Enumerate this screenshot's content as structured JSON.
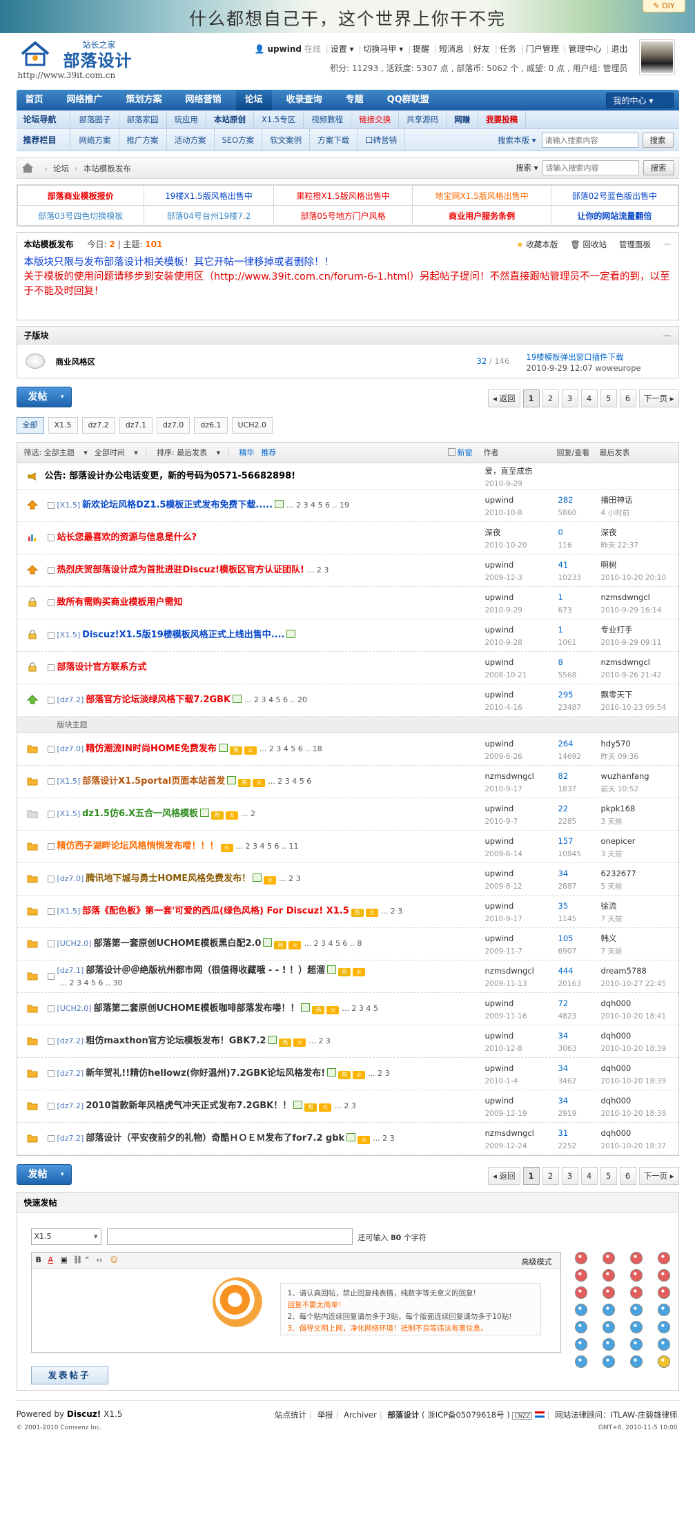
{
  "banner": {
    "slogan": "什么都想自己干，这个世界上你干不完",
    "diy": "DIY"
  },
  "logo": {
    "small": "站长之家",
    "big": "部落设计",
    "url": "http://www.39it.com.cn"
  },
  "user": {
    "name": "upwind",
    "status": "在线",
    "menu": [
      "设置",
      "切换马甲",
      "提醒",
      "短消息",
      "好友",
      "任务",
      "门户管理",
      "管理中心",
      "退出"
    ],
    "stats": "积分: 11293 , 活跃度: 5307 点 , 部落币: 5062 个 , 威望: 0 点 , 用户组: 管理员"
  },
  "nav": {
    "items": [
      "首页",
      "网络推广",
      "策划方案",
      "网络营销",
      "论坛",
      "收录查询",
      "专题",
      "QQ群联盟"
    ],
    "active": 4,
    "mycenter": "我的中心"
  },
  "subnav1": {
    "title": "论坛导航",
    "items": [
      "部落圈子",
      "部落家园",
      "玩应用",
      "本站原创",
      "X1.5专区",
      "视频教程",
      "链接交换",
      "共享源码",
      "网赚",
      "我要投稿"
    ]
  },
  "subnav2": {
    "title": "推荐栏目",
    "items": [
      "网络方案",
      "推广方案",
      "活动方案",
      "SEO方案",
      "软文案例",
      "方案下载",
      "口碑营销"
    ],
    "search_label": "搜索本版",
    "search_placeholder": "请输入搜索内容",
    "search_btn": "搜索"
  },
  "breadcrumb": {
    "items": [
      "论坛",
      "本站模板发布"
    ],
    "search_label": "搜索",
    "search_placeholder": "请输入搜索内容",
    "search_btn": "搜索"
  },
  "ads": [
    [
      "部落商业模板报价",
      "19楼X1.5版风格出售中",
      "果粒橙X1.5版风格出售中",
      "地宝网X1.5版风格出售中",
      "部落02号蓝色版出售中"
    ],
    [
      "部落03号四色切换模板",
      "部落04号台州19楼7.2",
      "部落05号地方门户风格",
      "商业用户服务条例",
      "让你的网站流量翻倍"
    ]
  ],
  "forum": {
    "name": "本站模板发布",
    "today_label": "今日:",
    "today": "2",
    "topics_label": "主题:",
    "topics": "101",
    "ops": [
      "收藏本版",
      "回收站",
      "管理面板"
    ],
    "rule1": "本版块只限与发布部落设计相关模板！其它开帖一律移掉或者删除！！",
    "rule2": "关于模板的使用问题请移步到安装使用区（http://www.39it.com.cn/forum-6-1.html）另起帖子提问！不然直接跟帖管理员不一定看的到，以至于不能及时回复！"
  },
  "subforum": {
    "title": "子版块",
    "name": "商业风格区",
    "threads": "32",
    "posts": "146",
    "last_title": "19楼模板弹出窗口插件下载",
    "last_info": "2010-9-29 12:07 woweurope"
  },
  "pager": {
    "post_btn": "发帖",
    "back": "返回",
    "pages": [
      "1",
      "2",
      "3",
      "4",
      "5",
      "6"
    ],
    "next": "下一页"
  },
  "type_tabs": [
    "全部",
    "X1.5",
    "dz7.2",
    "dz7.1",
    "dz7.0",
    "dz6.1",
    "UCH2.0"
  ],
  "list_header": {
    "filter": "筛选: 全部主题",
    "time": "全部时间",
    "sort": "排序: 最后发表",
    "digest": "精华",
    "recommend": "推荐",
    "newwin": "新窗",
    "author": "作者",
    "replies": "回复/查看",
    "lastpost": "最后发表"
  },
  "announcement": {
    "title": "公告: 部落设计办公电话变更，新的号码为0571-56682898!",
    "author": "爱，直至成伤",
    "date": "2010-9-29"
  },
  "sticky": [
    {
      "icon": "sticky3",
      "type": "[X1.5]",
      "title": "新欢论坛风格DZ1.5模板正式发布免费下载.....",
      "color": "c-blue",
      "pages": "... 2 3 4 5 6 .. 19",
      "author": "upwind",
      "date": "2010-10-8",
      "replies": "282",
      "views": "5860",
      "last_user": "播田神话",
      "last_time": "4 小时前",
      "img": true
    },
    {
      "icon": "poll",
      "type": "",
      "title": "站长您最喜欢的资源与信息是什么?",
      "color": "c-red",
      "pages": "",
      "author": "深夜",
      "date": "2010-10-20",
      "replies": "0",
      "views": "116",
      "last_user": "深夜",
      "last_time": "昨天 22:37"
    },
    {
      "icon": "sticky3",
      "type": "",
      "title": "热烈庆贺部落设计成为首批进驻Discuz!模板区官方认证团队!",
      "color": "c-red",
      "pages": "... 2 3",
      "author": "upwind",
      "date": "2009-12-3",
      "replies": "41",
      "views": "10233",
      "last_user": "啊树",
      "last_time": "2010-10-20 20:10"
    },
    {
      "icon": "lock",
      "type": "",
      "title": "致所有需购买商业模板用户需知",
      "color": "c-red",
      "pages": "",
      "author": "upwind",
      "date": "2010-9-29",
      "replies": "1",
      "views": "673",
      "last_user": "nzmsdwngcl",
      "last_time": "2010-9-29 16:14"
    },
    {
      "icon": "lock",
      "type": "[X1.5]",
      "title": "Discuz!X1.5版19楼模板风格正式上线出售中....",
      "color": "c-blue",
      "pages": "",
      "author": "upwind",
      "date": "2010-9-28",
      "replies": "1",
      "views": "1061",
      "last_user": "专业打手",
      "last_time": "2010-9-29 09:11",
      "img": true
    },
    {
      "icon": "lock",
      "type": "",
      "title": "部落设计官方联系方式",
      "color": "c-red",
      "pages": "",
      "author": "upwind",
      "date": "2008-10-21",
      "replies": "8",
      "views": "5568",
      "last_user": "nzmsdwngcl",
      "last_time": "2010-9-26 21:42"
    },
    {
      "icon": "sticky1",
      "type": "[dz7.2]",
      "title": "部落官方论坛淡绿风格下载7.2GBK",
      "color": "c-red",
      "pages": "... 2 3 4 5 6 .. 20",
      "author": "upwind",
      "date": "2010-4-16",
      "replies": "295",
      "views": "23487",
      "last_user": "飘零天下",
      "last_time": "2010-10-23 09:54",
      "img": true
    }
  ],
  "section_label": "版块主题",
  "threads": [
    {
      "type": "[dz7.0]",
      "title": "精仿潮流IN时尚HOME免费发布",
      "color": "c-red",
      "pages": "... 2 3 4 5 6 .. 18",
      "author": "upwind",
      "date": "2009-6-26",
      "replies": "264",
      "views": "14692",
      "last_user": "hdy570",
      "last_time": "昨天 09:36",
      "img": true,
      "hot": true,
      "rec": true
    },
    {
      "type": "[X1.5]",
      "title": "部落设计X1.5portal页面本站首发",
      "color": "c-brown",
      "pages": "... 2 3 4 5 6",
      "author": "nzmsdwngcl",
      "date": "2010-9-17",
      "replies": "82",
      "views": "1837",
      "last_user": "wuzhanfang",
      "last_time": "前天 10:52",
      "img": true,
      "hot": true,
      "rec": true
    },
    {
      "type": "[X1.5]",
      "title": "dz1.5仿6.X五合一风格模板",
      "color": "c-green",
      "pages": "... 2",
      "author": "upwind",
      "date": "2010-9-7",
      "replies": "22",
      "views": "2285",
      "last_user": "pkpk168",
      "last_time": "3 天前",
      "img": true,
      "hot": true,
      "rec": true
    },
    {
      "type": "",
      "title": "精仿西子湖畔论坛风格悄悄发布喽！！！",
      "color": "c-or",
      "pages": "... 2 3 4 5 6 .. 11",
      "author": "upwind",
      "date": "2009-6-14",
      "replies": "157",
      "views": "10845",
      "last_user": "onepicer",
      "last_time": "3 天前",
      "rec": true
    },
    {
      "type": "[dz7.0]",
      "title": "腾讯地下城与勇士HOME风格免费发布！",
      "color": "c-dbrown",
      "pages": "... 2 3",
      "author": "upwind",
      "date": "2009-8-12",
      "replies": "34",
      "views": "2887",
      "last_user": "6232677",
      "last_time": "5 天前",
      "img": true,
      "rec": true
    },
    {
      "type": "[X1.5]",
      "title": "部落《配色板》第一套'可爱的西瓜(绿色风格) For Discuz! X1.5",
      "color": "c-red",
      "pages": "... 2 3",
      "author": "upwind",
      "date": "2010-9-17",
      "replies": "35",
      "views": "1145",
      "last_user": "徐流",
      "last_time": "7 天前",
      "hot": true,
      "rec": true
    },
    {
      "type": "[UCH2.0]",
      "title": "部落第一套原创UCHOME模板黑白配2.0",
      "color": "c-dark",
      "pages": "... 2 3 4 5 6 .. 8",
      "author": "upwind",
      "date": "2009-11-7",
      "replies": "105",
      "views": "6907",
      "last_user": "韩义",
      "last_time": "7 天前",
      "img": true,
      "hot": true,
      "rec": true
    },
    {
      "type": "[dz7.1]",
      "title": "部落设计＠＠绝版杭州都市网（很值得收藏哦 - - ! ！）超溜",
      "color": "c-dark",
      "pages": "... 2 3 4 5 6 .. 30",
      "author": "nzmsdwngcl",
      "date": "2009-11-13",
      "replies": "444",
      "views": "20163",
      "last_user": "dream5788",
      "last_time": "2010-10-27 22:45",
      "img": true,
      "hot": true,
      "rec": true,
      "wrap": true
    },
    {
      "type": "[UCH2.0]",
      "title": "部落第二套原创UCHOME模板咖啡部落发布喽！！",
      "color": "c-dark",
      "pages": "... 2 3 4 5",
      "author": "upwind",
      "date": "2009-11-16",
      "replies": "72",
      "views": "4823",
      "last_user": "dqh000",
      "last_time": "2010-10-20 18:41",
      "img": true,
      "hot": true,
      "rec": true
    },
    {
      "type": "[dz7.2]",
      "title": "粗仿maxthon官方论坛模板发布！GBK7.2",
      "color": "c-dark",
      "pages": "... 2 3",
      "author": "upwind",
      "date": "2010-12-8",
      "replies": "34",
      "views": "3063",
      "last_user": "dqh000",
      "last_time": "2010-10-20 18:39",
      "img": true,
      "hot": true,
      "rec": true
    },
    {
      "type": "[dz7.2]",
      "title": "新年贺礼!!精仿hellowz(你好温州)7.2GBK论坛风格发布!",
      "color": "c-dark",
      "pages": "... 2 3",
      "author": "upwind",
      "date": "2010-1-4",
      "replies": "34",
      "views": "3462",
      "last_user": "dqh000",
      "last_time": "2010-10-20 18:39",
      "img": true,
      "hot": true,
      "rec": true
    },
    {
      "type": "[dz7.2]",
      "title": "2010首款新年风格虎气冲天正式发布7.2GBK！！",
      "color": "c-dark",
      "pages": "... 2 3",
      "author": "upwind",
      "date": "2009-12-19",
      "replies": "34",
      "views": "2919",
      "last_user": "dqh000",
      "last_time": "2010-10-20 18:38",
      "img": true,
      "hot": true,
      "rec": true
    },
    {
      "type": "[dz7.2]",
      "title": "部落设计（平安夜前夕的礼物）奇酷ＨＯＥＭ发布了for7.2 gbk",
      "color": "c-dark",
      "pages": "... 2 3",
      "author": "nzmsdwngcl",
      "date": "2009-12-24",
      "replies": "31",
      "views": "2252",
      "last_user": "dqh000",
      "last_time": "2010-10-20 18:37",
      "img": true,
      "rec": true
    }
  ],
  "quickpost": {
    "title": "快速发帖",
    "type_selected": "X1.5",
    "hint_pre": "还可输入",
    "hint_num": "80",
    "hint_post": "个字符",
    "advanced": "高级模式",
    "notice": [
      "1、请认真回帖，禁止回复纯表情，纯数字等无意义的回复!",
      "回复不要太简单!",
      "2、每个贴内连续回复请勿多于3贴，每个版面连续回复请勿多于10贴!",
      "3、倡导文明上网，净化网络环境！抵制不良等违法有害信息。"
    ],
    "submit": "发表帖子"
  },
  "footer": {
    "powered": "Powered by",
    "brand": "Discuz!",
    "version": "X1.5",
    "copyright": "© 2001-2010 Comsenz Inc.",
    "links": [
      "站点统计",
      "举报",
      "Archiver",
      "部落设计",
      "( 浙ICP备05079618号 )",
      "网站法律顾问：ITLAW-庄毅雄律师"
    ],
    "time": "GMT+8, 2010-11-5 10:00"
  },
  "colors": {
    "nav": "#1d5ea5",
    "red": "#e00000",
    "blue": "#0647c9",
    "orange": "#ff6a00"
  }
}
